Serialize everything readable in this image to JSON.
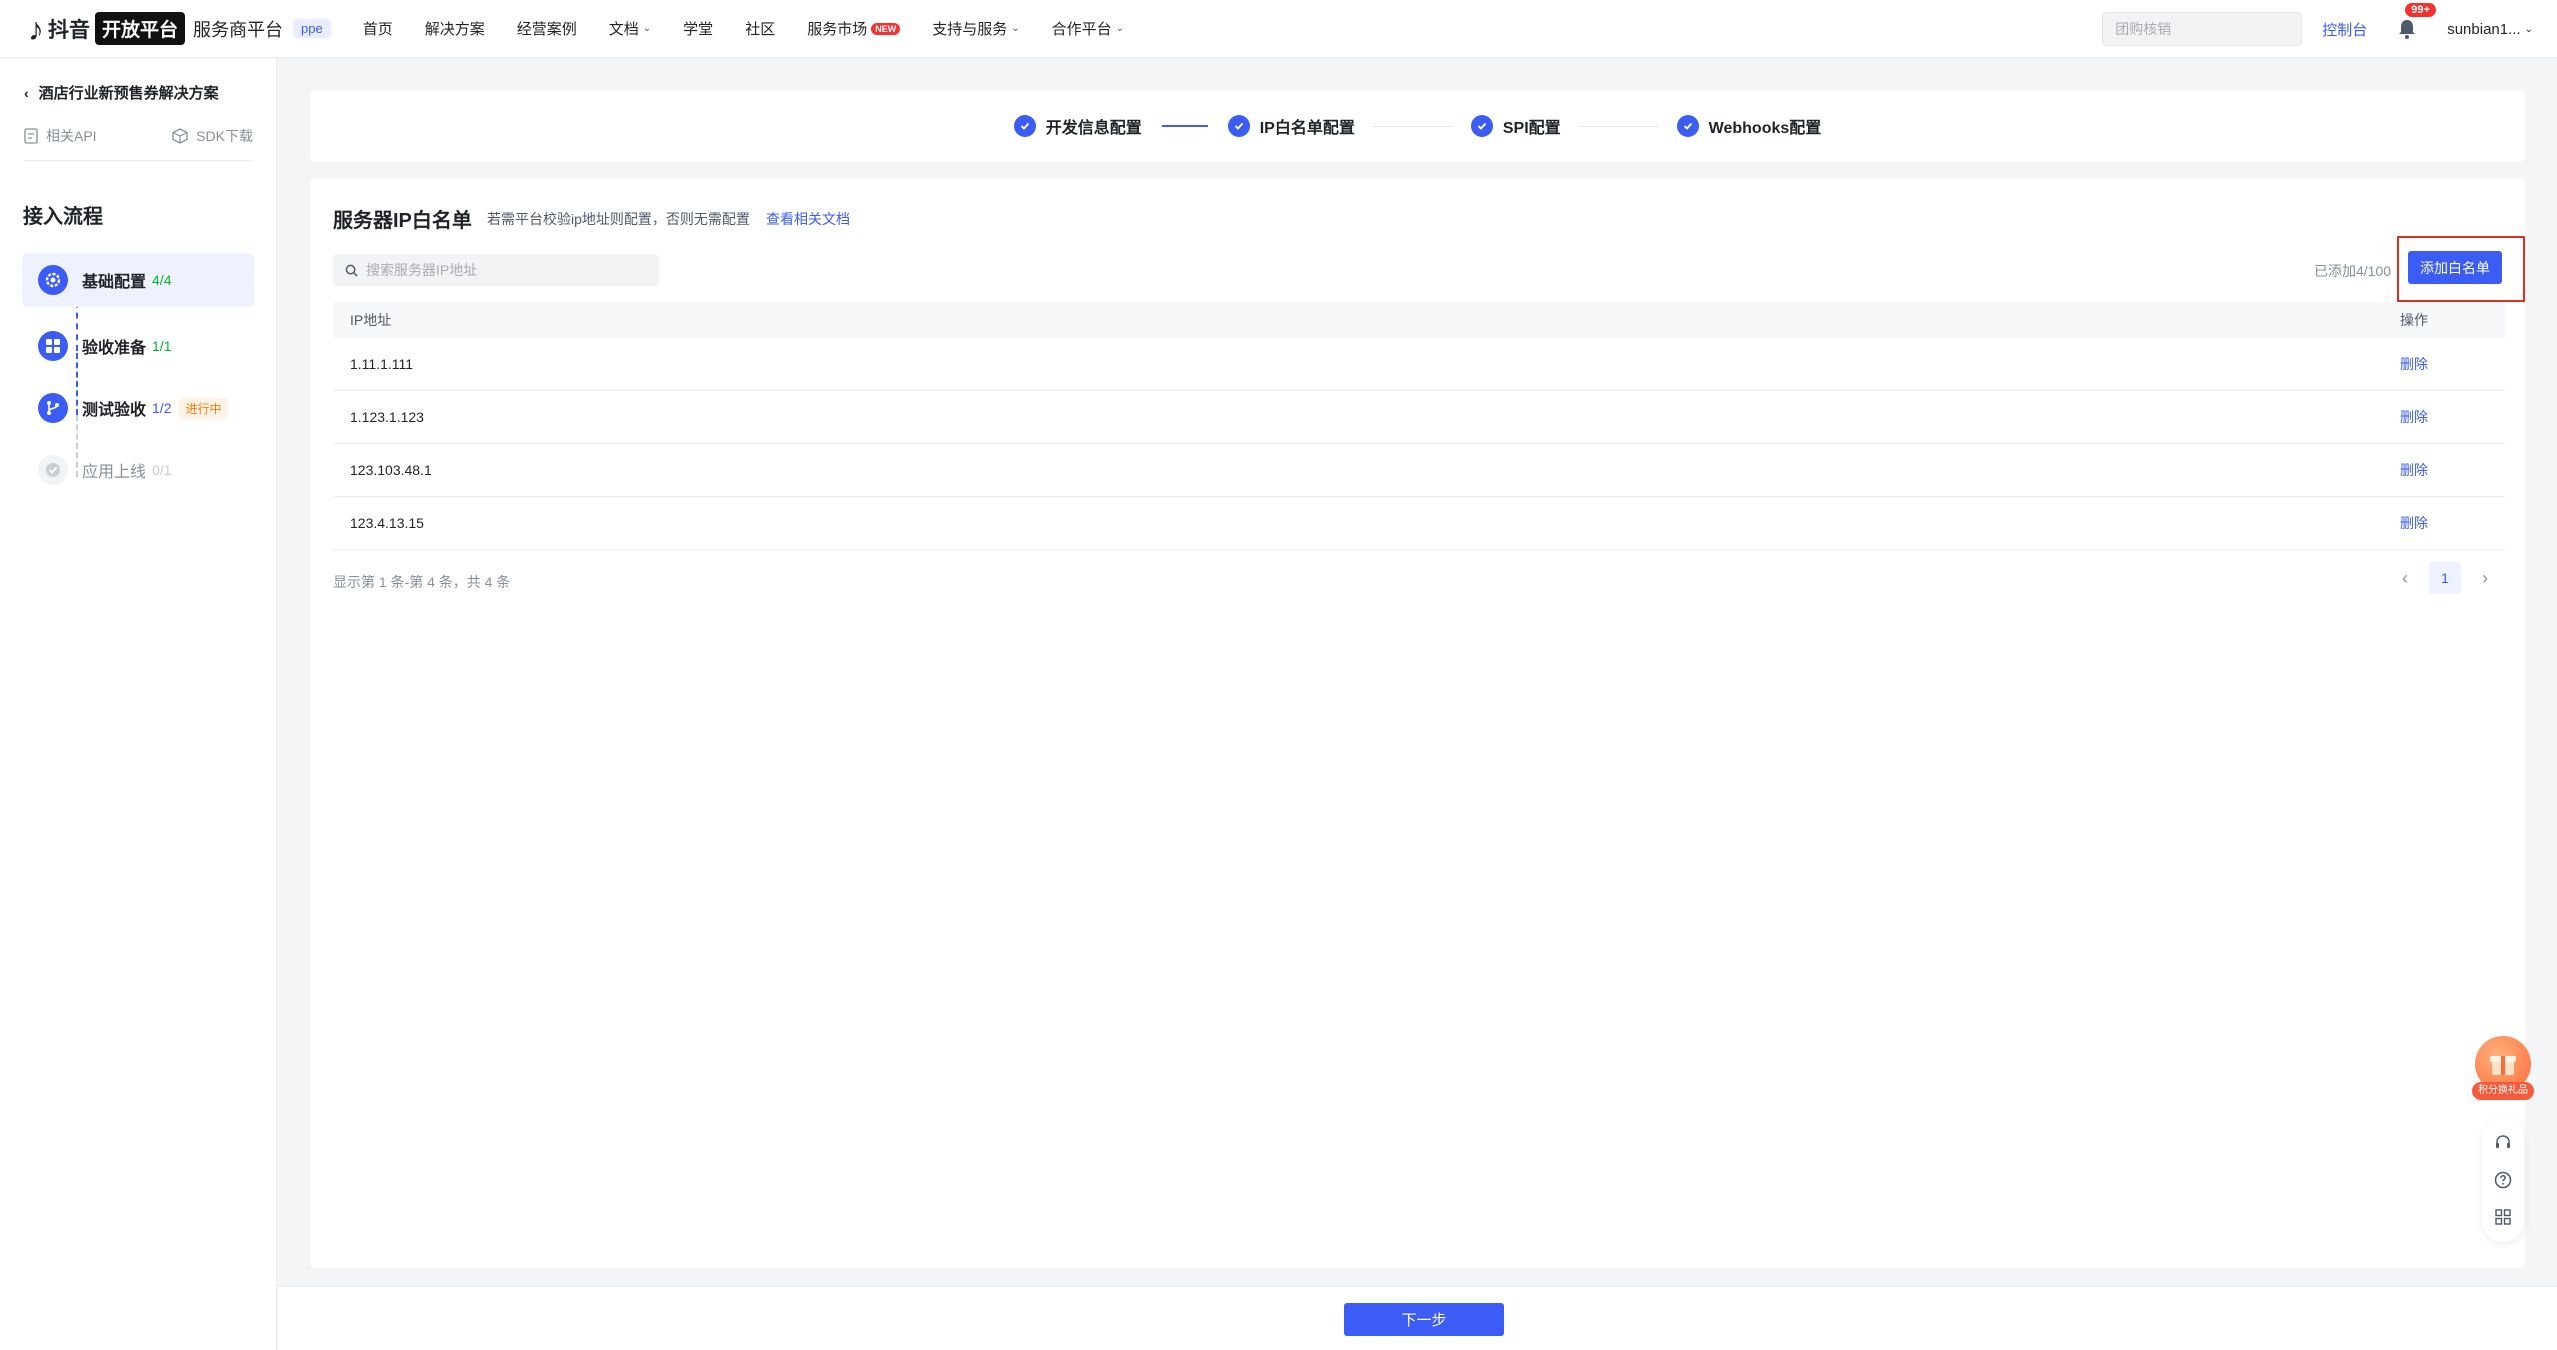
{
  "header": {
    "logo_mark": "♪",
    "logo_text": "抖音",
    "logo_badge": "开放平台",
    "platform_name": "服务商平台",
    "env_badge": "ppe",
    "nav": [
      {
        "label": "首页"
      },
      {
        "label": "解决方案"
      },
      {
        "label": "经营案例"
      },
      {
        "label": "文档",
        "dropdown": true
      },
      {
        "label": "学堂"
      },
      {
        "label": "社区"
      },
      {
        "label": "服务市场",
        "new_badge": "NEW"
      },
      {
        "label": "支持与服务",
        "dropdown": true
      },
      {
        "label": "合作平台",
        "dropdown": true
      }
    ],
    "search_placeholder": "团购核销",
    "console_label": "控制台",
    "notification_count": "99+",
    "username": "sunbian1..."
  },
  "sidebar": {
    "back_label": "酒店行业新预售券解决方案",
    "links": [
      {
        "label": "相关API",
        "icon": "document-icon"
      },
      {
        "label": "SDK下载",
        "icon": "package-icon"
      }
    ],
    "flow_title": "接入流程",
    "steps": [
      {
        "label": "基础配置",
        "count": "4/4",
        "icon": "gear-icon",
        "status": "done"
      },
      {
        "label": "验收准备",
        "count": "1/1",
        "icon": "grid-icon",
        "status": "done"
      },
      {
        "label": "测试验收",
        "count": "1/2",
        "icon": "branch-icon",
        "status": "in-progress",
        "tag": "进行中"
      },
      {
        "label": "应用上线",
        "count": "0/1",
        "icon": "check-circle-icon",
        "status": "pending"
      }
    ]
  },
  "stepper": [
    {
      "label": "开发信息配置"
    },
    {
      "label": "IP白名单配置"
    },
    {
      "label": "SPI配置"
    },
    {
      "label": "Webhooks配置"
    }
  ],
  "whitelist": {
    "title": "服务器IP白名单",
    "hint": "若需平台校验ip地址则配置，否则无需配置",
    "doc_link": "查看相关文档",
    "search_placeholder": "搜索服务器IP地址",
    "added_count": "已添加4/100",
    "add_button": "添加白名单",
    "columns": [
      "IP地址",
      "操作"
    ],
    "rows": [
      {
        "ip": "1.11.1.111",
        "action": "删除"
      },
      {
        "ip": "1.123.1.123",
        "action": "删除"
      },
      {
        "ip": "123.103.48.1",
        "action": "删除"
      },
      {
        "ip": "123.4.13.15",
        "action": "删除"
      }
    ],
    "pagination_info": "显示第 1 条-第 4 条，共 4 条",
    "current_page": "1"
  },
  "footer": {
    "next_button": "下一步"
  },
  "floating": {
    "gift_label": "积分换礼品"
  },
  "colors": {
    "primary": "#3b5cf5",
    "success": "#00b42a",
    "highlight": "#e0301e",
    "warning": "#ff7d00"
  }
}
